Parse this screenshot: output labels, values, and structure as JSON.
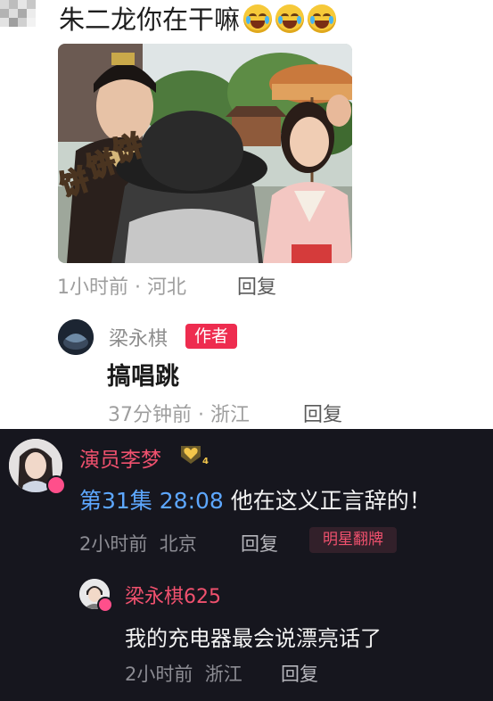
{
  "comment1": {
    "text": "朱二龙你在干嘛",
    "emojis": [
      "crying-laughing-emoji",
      "crying-laughing-emoji",
      "crying-laughing-emoji"
    ],
    "photo_caption": "饼",
    "time_location": "1小时前 · 河北",
    "reply_label": "回复"
  },
  "reply1": {
    "author": "梁永棋",
    "badge": "作者",
    "text": "搞唱跳",
    "time_location": "37分钟前 · 浙江",
    "reply_label": "回复"
  },
  "comment2": {
    "author": "演员李梦",
    "episode_link": "第31集 28:08",
    "text": " 他在这义正言辞的！",
    "time": "2小时前",
    "location": "北京",
    "reply_label": "回复",
    "tag": "明星翻牌",
    "level_badge": "4"
  },
  "reply2": {
    "author": "梁永棋625",
    "text": "我的充电器最会说漂亮话了",
    "time": "2小时前",
    "location": "浙江",
    "reply_label": "回复"
  },
  "colors": {
    "author_badge": "#ee2c4f",
    "dark_bg": "#16161e",
    "pink_name": "#f0516e",
    "episode_link": "#5da7ff"
  }
}
